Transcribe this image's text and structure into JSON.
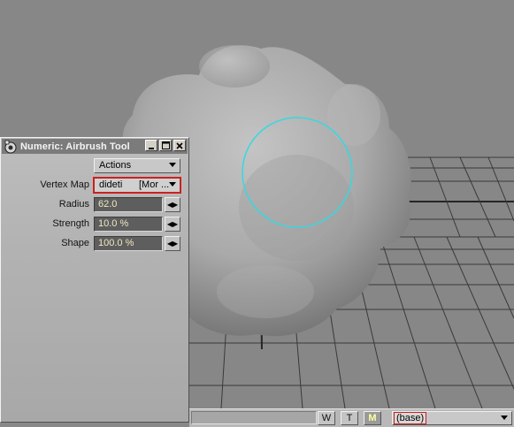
{
  "panel": {
    "title": "Numeric: Airbrush Tool",
    "window_buttons": [
      "minimize-icon",
      "maximize-icon",
      "close-icon"
    ],
    "actions_label": "Actions",
    "fields": [
      {
        "label": "Vertex Map",
        "value": "dideti",
        "value2": "[Mor ..."
      },
      {
        "label": "Radius",
        "value": "62.0"
      },
      {
        "label": "Strength",
        "value": "10.0 %"
      },
      {
        "label": "Shape",
        "value": "100.0 %"
      }
    ]
  },
  "statusbar": {
    "modes": [
      "W",
      "T",
      "M"
    ],
    "active_mode": "M",
    "layer": "(base)"
  },
  "viewport": {
    "brush_color": "#37d8e0",
    "object": "sculpted-blob-mesh"
  }
}
